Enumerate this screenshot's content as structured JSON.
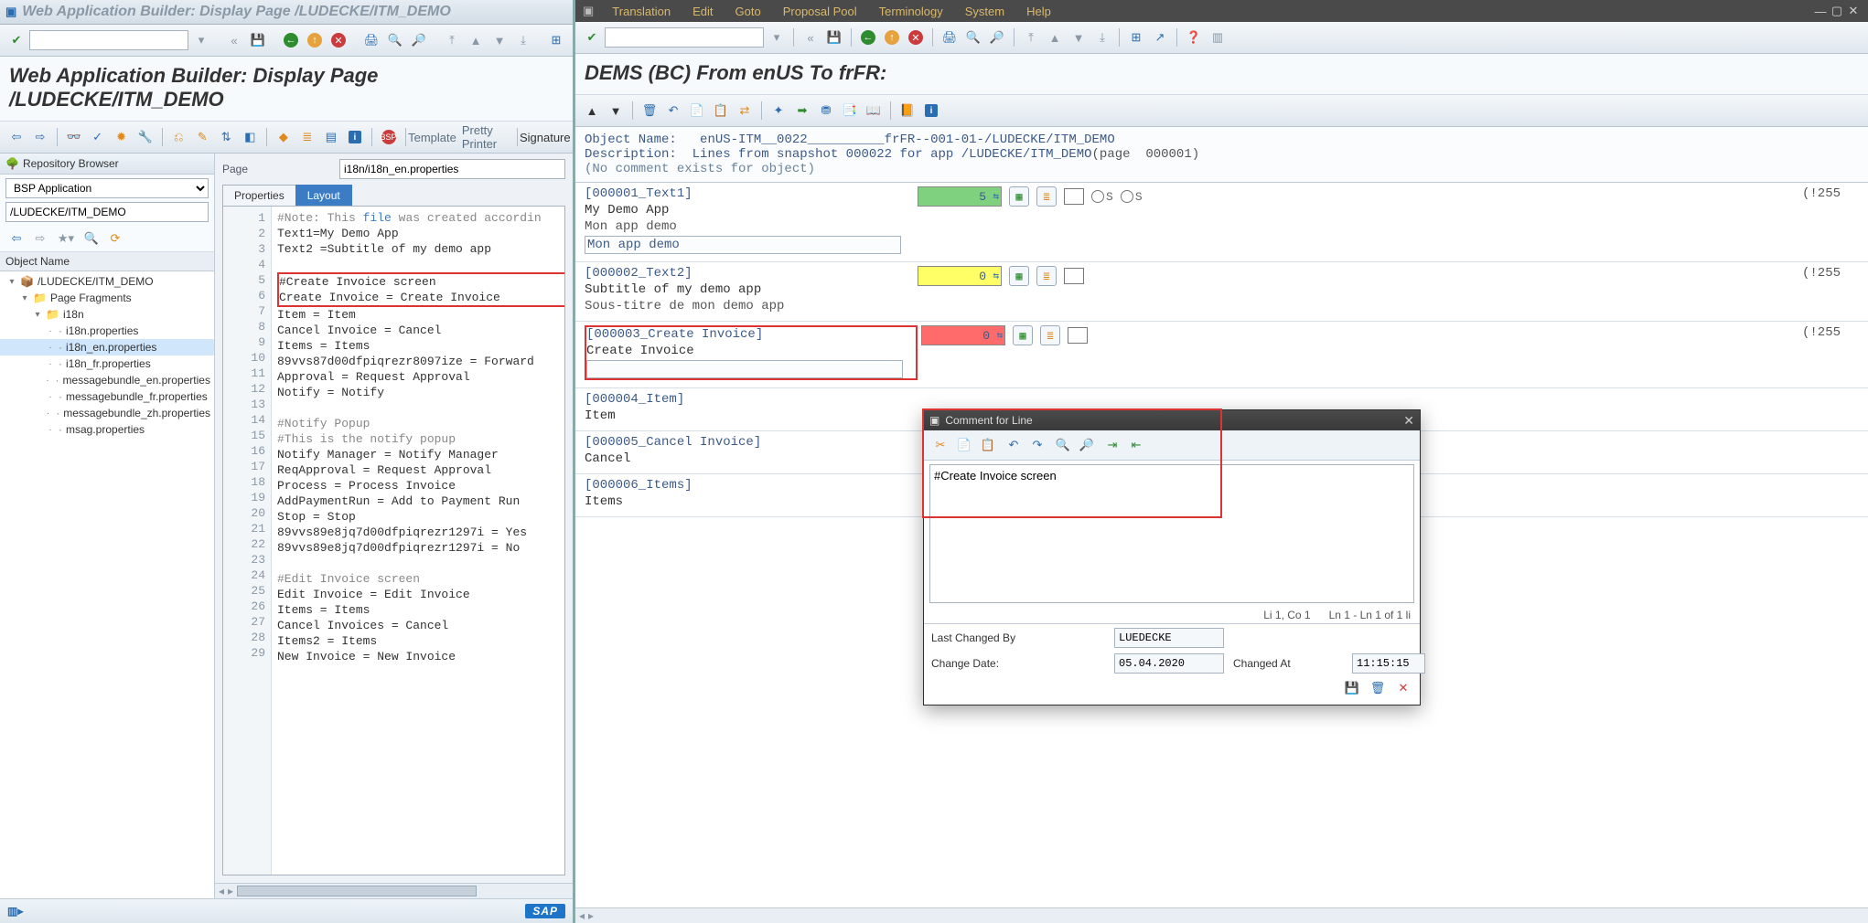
{
  "left": {
    "window_title": "Web Application Builder: Display Page /LUDECKE/ITM_DEMO",
    "heading": "Web Application Builder: Display Page /LUDECKE/ITM_DEMO",
    "tool_template": "Template",
    "tool_pretty": "Pretty Printer",
    "tool_signature": "Signature",
    "repo": {
      "title": "Repository Browser",
      "type": "BSP Application",
      "path": "/LUDECKE/ITM_DEMO",
      "col_hdr": "Object Name",
      "tree": [
        {
          "lvl": 0,
          "tw": "▾",
          "icon": "pkg",
          "label": "/LUDECKE/ITM_DEMO"
        },
        {
          "lvl": 1,
          "tw": "▾",
          "icon": "folder",
          "label": "Page Fragments"
        },
        {
          "lvl": 2,
          "tw": "▾",
          "icon": "folder",
          "label": "i18n"
        },
        {
          "lvl": 3,
          "tw": "·",
          "icon": "file",
          "label": "i18n.properties"
        },
        {
          "lvl": 3,
          "tw": "·",
          "icon": "file",
          "label": "i18n_en.properties",
          "sel": true
        },
        {
          "lvl": 3,
          "tw": "·",
          "icon": "file",
          "label": "i18n_fr.properties"
        },
        {
          "lvl": 3,
          "tw": "·",
          "icon": "file",
          "label": "messagebundle_en.properties"
        },
        {
          "lvl": 3,
          "tw": "·",
          "icon": "file",
          "label": "messagebundle_fr.properties"
        },
        {
          "lvl": 3,
          "tw": "·",
          "icon": "file",
          "label": "messagebundle_zh.properties"
        },
        {
          "lvl": 3,
          "tw": "·",
          "icon": "file",
          "label": "msag.properties"
        }
      ]
    },
    "editor": {
      "page_label": "Page",
      "page_value": "i18n/i18n_en.properties",
      "tab_properties": "Properties",
      "tab_layout": "Layout",
      "lines": [
        {
          "n": 1,
          "t": "#Note: This file was created accordin",
          "cls": "cm",
          "hlword": "file"
        },
        {
          "n": 2,
          "t": "Text1=My Demo App"
        },
        {
          "n": 3,
          "t": "Text2 =Subtitle of my demo app"
        },
        {
          "n": 4,
          "t": ""
        },
        {
          "n": 5,
          "t": "#Create Invoice screen",
          "box": "start"
        },
        {
          "n": 6,
          "t": "Create Invoice = Create Invoice",
          "box": "end"
        },
        {
          "n": 7,
          "t": "Item = Item"
        },
        {
          "n": 8,
          "t": "Cancel Invoice = Cancel"
        },
        {
          "n": 9,
          "t": "Items = Items"
        },
        {
          "n": 10,
          "t": "89vvs87d00dfpiqrezr8097ize = Forward"
        },
        {
          "n": 11,
          "t": "Approval = Request Approval"
        },
        {
          "n": 12,
          "t": "Notify = Notify"
        },
        {
          "n": 13,
          "t": ""
        },
        {
          "n": 14,
          "t": "#Notify Popup",
          "cls": "cm"
        },
        {
          "n": 15,
          "t": "#This is the notify popup",
          "cls": "cm"
        },
        {
          "n": 16,
          "t": "Notify Manager = Notify Manager"
        },
        {
          "n": 17,
          "t": "ReqApproval = Request Approval"
        },
        {
          "n": 18,
          "t": "Process = Process Invoice"
        },
        {
          "n": 19,
          "t": "AddPaymentRun = Add to Payment Run"
        },
        {
          "n": 20,
          "t": "Stop = Stop"
        },
        {
          "n": 21,
          "t": "89vvs89e8jq7d00dfpiqrezr1297i = Yes"
        },
        {
          "n": 22,
          "t": "89vvs89e8jq7d00dfpiqrezr1297i = No"
        },
        {
          "n": 23,
          "t": ""
        },
        {
          "n": 24,
          "t": "#Edit Invoice screen",
          "cls": "cm"
        },
        {
          "n": 25,
          "t": "Edit Invoice = Edit Invoice"
        },
        {
          "n": 26,
          "t": "Items = Items"
        },
        {
          "n": 27,
          "t": "Cancel Invoices = Cancel"
        },
        {
          "n": 28,
          "t": "Items2 = Items"
        },
        {
          "n": 29,
          "t": "New Invoice = New Invoice"
        }
      ]
    }
  },
  "right": {
    "menus": [
      "Translation",
      "Edit",
      "Goto",
      "Proposal Pool",
      "Terminology",
      "System",
      "Help"
    ],
    "heading": "DEMS (BC) From enUS To frFR:",
    "obj": {
      "name_label": "Object Name:",
      "name_value": "enUS-ITM__0022__________frFR--001-01-/LUDECKE/ITM_DEMO",
      "desc_label": "Description:",
      "desc_value": "Lines from snapshot 000022 for app /LUDECKE/ITM_DEMO",
      "page": "(page  000001)",
      "comment": "(No comment exists for object)"
    },
    "blocks": [
      {
        "key": "[000001_Text1]",
        "src": "My Demo App",
        "tgt": "Mon app demo",
        "editable": true,
        "editValue": "Mon app demo",
        "score": "5",
        "scoreCls": "green",
        "showRadios": true,
        "len": "(!255"
      },
      {
        "key": "[000002_Text2]",
        "src": "Subtitle of my demo app",
        "tgt": "Sous-titre de mon demo app",
        "score": "0",
        "scoreCls": "yellow",
        "len": "(!255"
      },
      {
        "key": "[000003_Create Invoice]",
        "src": "Create Invoice",
        "tgt": "",
        "editable": true,
        "editValue": "",
        "score": "0",
        "scoreCls": "red",
        "len": "(!255",
        "box": true
      },
      {
        "key": "[000004_Item]",
        "src": "Item"
      },
      {
        "key": "[000005_Cancel Invoice]",
        "src": "Cancel"
      },
      {
        "key": "[000006_Items]",
        "src": "Items"
      }
    ]
  },
  "dialog": {
    "title": "Comment for Line",
    "text": "#Create Invoice screen",
    "status_pos": "Li 1, Co 1",
    "status_range": "Ln 1 - Ln 1 of 1 li",
    "lbl_lastby": "Last Changed By",
    "val_lastby": "LUEDECKE",
    "lbl_date": "Change Date:",
    "val_date": "05.04.2020",
    "lbl_at": "Changed At",
    "val_at": "11:15:15"
  }
}
